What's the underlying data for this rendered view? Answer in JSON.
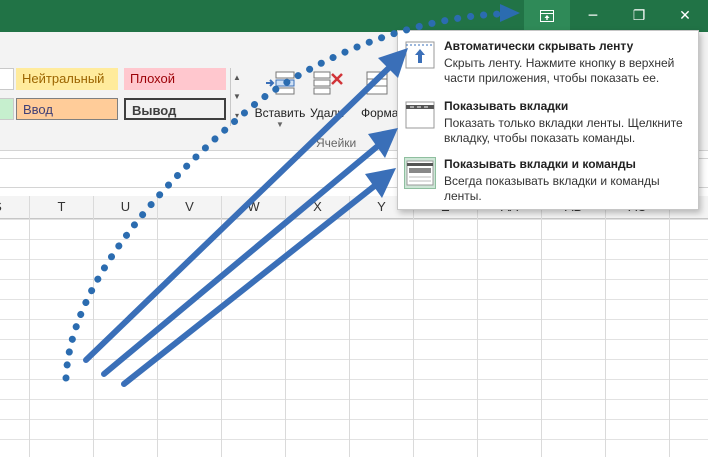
{
  "window_controls": {
    "ribbon_options_icon": "ribbon-display-options-icon",
    "minimize_glyph": "─",
    "restore_glyph": "❐",
    "close_glyph": "✕"
  },
  "ribbon": {
    "styles": [
      {
        "label": "Нейтральный",
        "bg": "#ffeb9c",
        "fg": "#9c6500"
      },
      {
        "label": "Плохой",
        "bg": "#ffc7ce",
        "fg": "#9c0006"
      },
      {
        "label": "Ввод",
        "bg": "#ffcc99",
        "fg": "#3f3f76"
      },
      {
        "label": "Вывод",
        "bg": "#f2f2f2",
        "fg": "#3f3f3f"
      }
    ],
    "cells_group": {
      "insert_label": "Вставить",
      "delete_label": "Удали",
      "format_label": "Форма",
      "group_label": "Ячейки"
    }
  },
  "columns": [
    "S",
    "T",
    "U",
    "V",
    "W",
    "X",
    "Y",
    "Z",
    "AA",
    "AB",
    "AC"
  ],
  "ribbon_display_menu": {
    "items": [
      {
        "title": "Автоматически скрывать ленту",
        "description": "Скрыть ленту. Нажмите кнопку в верхней части приложения, чтобы показать ее."
      },
      {
        "title": "Показывать вкладки",
        "description": "Показать только вкладки ленты. Щелкните вкладку, чтобы показать команды."
      },
      {
        "title": "Показывать вкладки и команды",
        "description": "Всегда показывать вкладки и команды ленты."
      }
    ]
  },
  "colors": {
    "title_bar": "#217346",
    "arrow": "#3a6fb8",
    "selected_item_bg": "#cde6d6"
  }
}
